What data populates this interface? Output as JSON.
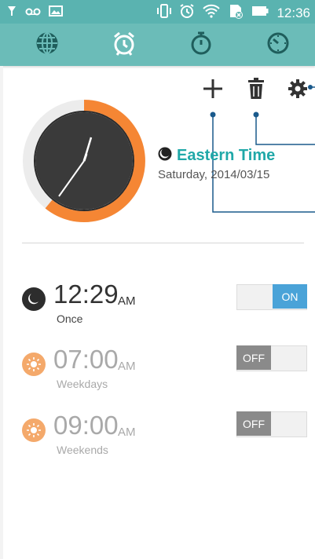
{
  "status_bar": {
    "time": "12:36",
    "left_icons": [
      "ring-icon",
      "voicemail-icon",
      "image-icon"
    ],
    "right_icons": [
      "vibrate-icon",
      "alarm-status-icon",
      "wifi-icon",
      "sim-icon",
      "battery-icon"
    ]
  },
  "tabs": [
    {
      "name": "world-clock",
      "icon": "globe-icon"
    },
    {
      "name": "alarm",
      "icon": "alarm-clock-icon",
      "selected": true
    },
    {
      "name": "stopwatch",
      "icon": "stopwatch-icon"
    },
    {
      "name": "timer",
      "icon": "timer-icon"
    }
  ],
  "toolbar": {
    "icons": [
      "plus-icon",
      "trash-icon",
      "gear-icon"
    ]
  },
  "world_clock": {
    "timezone": "Eastern Time",
    "date": "Saturday, 2014/03/15",
    "night_icon": "moon-icon"
  },
  "alarms": [
    {
      "time": "12:29",
      "ampm": "AM",
      "label": "Once",
      "enabled": true,
      "icon": "moon-icon",
      "toggle_text": "ON"
    },
    {
      "time": "07:00",
      "ampm": "AM",
      "label": "Weekdays",
      "enabled": false,
      "icon": "sun-icon",
      "toggle_text": "OFF"
    },
    {
      "time": "09:00",
      "ampm": "AM",
      "label": "Weekends",
      "enabled": false,
      "icon": "sun-icon",
      "toggle_text": "OFF"
    }
  ],
  "colors": {
    "accent": "#5ab3b0",
    "tabbar": "#6bbcb8",
    "teal_text": "#20a8a8",
    "orange_ring": "#f58634",
    "on_blue": "#4aa3d8",
    "off_gray": "#8a8a8a",
    "sun_orange": "#f4a96b"
  }
}
